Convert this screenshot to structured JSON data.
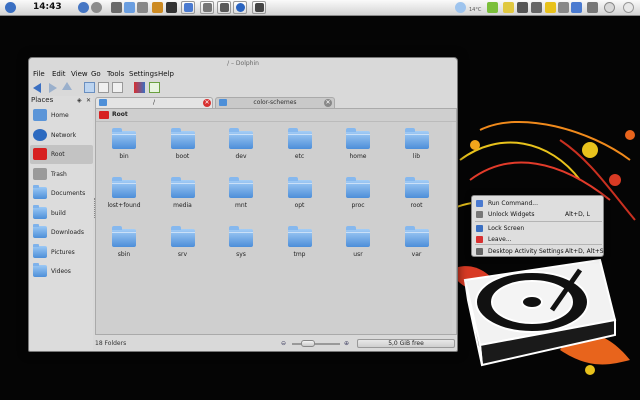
{
  "panel": {
    "clock": "14:43",
    "weather_temp": "14°C"
  },
  "window": {
    "title": "/ – Dolphin",
    "menus": [
      "File",
      "Edit",
      "View",
      "Go",
      "Tools",
      "Settings",
      "Help"
    ]
  },
  "places": {
    "header": "Places",
    "items": [
      {
        "label": "Home",
        "icon": "home-icon"
      },
      {
        "label": "Network",
        "icon": "globe-icon"
      },
      {
        "label": "Root",
        "icon": "root-folder-icon"
      },
      {
        "label": "Trash",
        "icon": "trash-icon"
      },
      {
        "label": "Documents",
        "icon": "folder-icon"
      },
      {
        "label": "build",
        "icon": "folder-icon"
      },
      {
        "label": "Downloads",
        "icon": "folder-icon"
      },
      {
        "label": "Pictures",
        "icon": "folder-icon"
      },
      {
        "label": "Videos",
        "icon": "folder-icon"
      }
    ]
  },
  "tabs": [
    {
      "label": "/",
      "active": true
    },
    {
      "label": "color-schemes",
      "active": false
    }
  ],
  "location": "Root",
  "folders": [
    "bin",
    "boot",
    "dev",
    "etc",
    "home",
    "lib",
    "lost+found",
    "media",
    "mnt",
    "opt",
    "proc",
    "root",
    "sbin",
    "srv",
    "sys",
    "tmp",
    "usr",
    "var"
  ],
  "status": {
    "text": "18 Folders",
    "free_space": "5,0 GiB free"
  },
  "context_menu": {
    "items": [
      {
        "label": "Run Command...",
        "shortcut": "",
        "icon": "run-command-icon"
      },
      {
        "label": "Unlock Widgets",
        "shortcut": "Alt+D, L",
        "icon": "unlock-icon"
      },
      {
        "label": "Lock Screen",
        "shortcut": "",
        "icon": "lock-icon"
      },
      {
        "label": "Leave...",
        "shortcut": "",
        "icon": "leave-icon"
      },
      {
        "label": "Desktop Activity Settings",
        "shortcut": "Alt+D, Alt+S",
        "icon": "desktop-settings-icon"
      }
    ]
  },
  "colors": {
    "accent_blue": "#4d8fd8",
    "root_red": "#d72020",
    "tab_close_red": "#d83030"
  }
}
